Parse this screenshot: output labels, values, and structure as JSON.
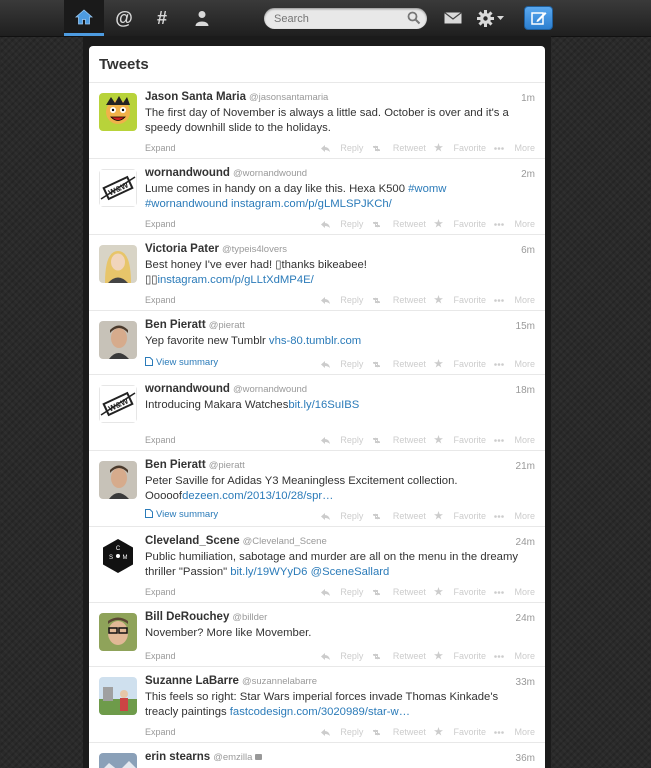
{
  "header": {
    "search_placeholder": "Search"
  },
  "panel": {
    "title": "Tweets"
  },
  "actions": {
    "reply": "Reply",
    "retweet": "Retweet",
    "favorite": "Favorite",
    "more": "More"
  },
  "tweets": [
    {
      "name": "Jason Santa Maria",
      "handle": "@jasonsantamaria",
      "time": "1m",
      "text": "The first day of November is always a little sad. October is over and it's a speedy downhill slide to the holidays.",
      "link": "",
      "expand": "Expand"
    },
    {
      "name": "wornandwound",
      "handle": "@wornandwound",
      "time": "2m",
      "text": "Lume comes in handy on a day like this. Hexa K500 ",
      "link": "#womw #wornandwound instagram.com/p/gLMLSPJKCh/",
      "expand": "Expand"
    },
    {
      "name": "Victoria Pater",
      "handle": "@typeis4lovers",
      "time": "6m",
      "text": "Best honey I've ever had! ▯thanks bikeabee! ▯▯",
      "link": "instagram.com/p/gLLtXdMP4E/",
      "expand": "Expand"
    },
    {
      "name": "Ben Pieratt",
      "handle": "@pieratt",
      "time": "15m",
      "text": "Yep favorite new Tumblr ",
      "link": "vhs-80.tumblr.com",
      "expand": "View summary"
    },
    {
      "name": "wornandwound",
      "handle": "@wornandwound",
      "time": "18m",
      "text": "Introducing Makara Watches",
      "link": "bit.ly/16SuIBS",
      "expand": "Expand"
    },
    {
      "name": "Ben Pieratt",
      "handle": "@pieratt",
      "time": "21m",
      "text": "Peter Saville for Adidas Y3 Meaningless Excitement collection. Ooooof",
      "link": "dezeen.com/2013/10/28/spr…",
      "expand": "View summary"
    },
    {
      "name": "Cleveland_Scene",
      "handle": "@Cleveland_Scene",
      "time": "24m",
      "text": "Public humiliation, sabotage and murder are all on the menu in the dreamy thriller \"Passion\" ",
      "link": "bit.ly/19WYyD6 @SceneSallard",
      "expand": "Expand"
    },
    {
      "name": "Bill DeRouchey",
      "handle": "@billder",
      "time": "24m",
      "text": "November? More like Movember.",
      "link": "",
      "expand": "Expand"
    },
    {
      "name": "Suzanne LaBarre",
      "handle": "@suzannelabarre",
      "time": "33m",
      "text": "This feels so right: Star Wars imperial forces invade Thomas Kinkade's treacly paintings ",
      "link": "fastcodesign.com/3020989/star-w…",
      "expand": "Expand"
    },
    {
      "name": "erin stearns",
      "handle": "@emzilla",
      "time": "36m",
      "text": "",
      "link": "",
      "expand": ""
    }
  ]
}
